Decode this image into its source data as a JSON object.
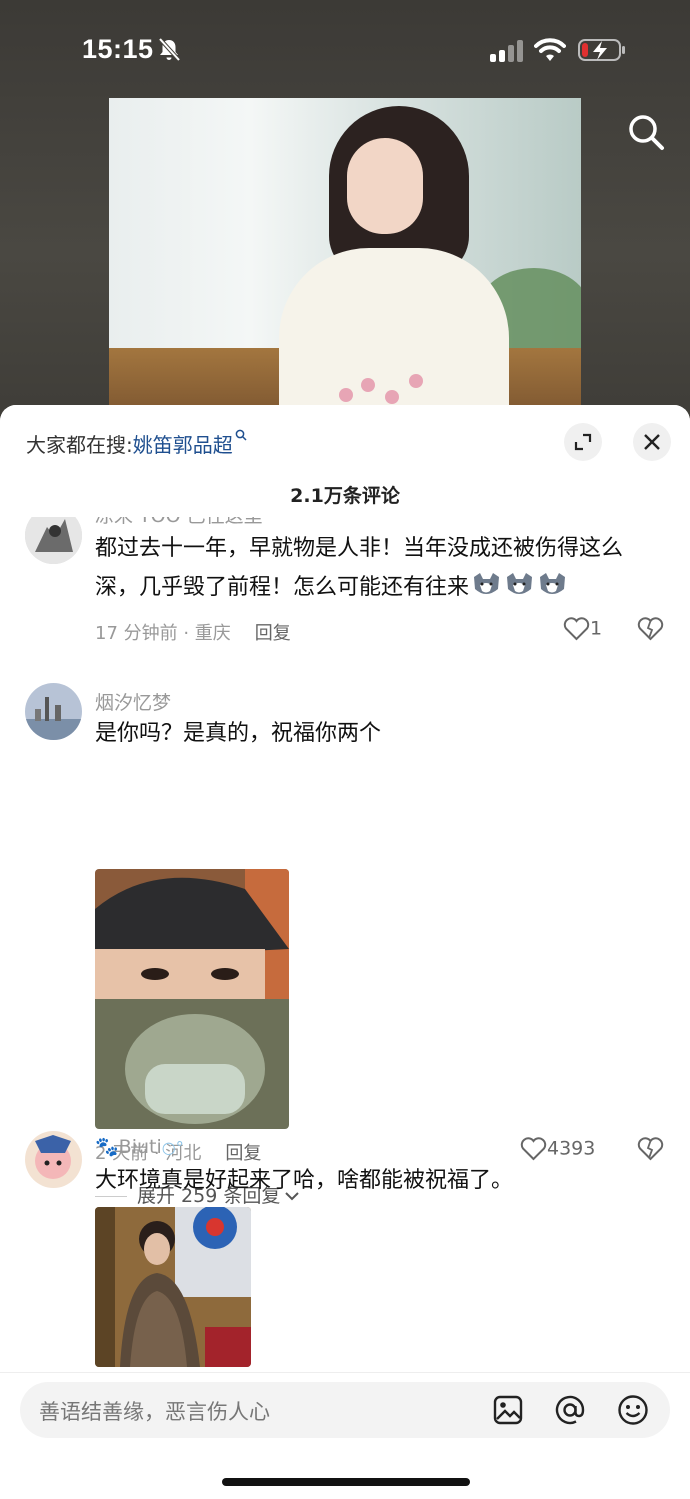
{
  "status_bar": {
    "time": "15:15"
  },
  "hot_search": {
    "prefix": "大家都在搜:",
    "keyword": "姚笛郭品超"
  },
  "comment_count": "2.1万条评论",
  "comments": [
    {
      "username": "凉宋 TOO 已往这里",
      "text": "都过去十一年，早就物是人非！当年没成还被伤得这么深，几乎毁了前程！怎么可能还有往来",
      "emoji_count": 3,
      "time_location": "17 分钟前 · 重庆",
      "reply_label": "回复",
      "likes": "1"
    },
    {
      "username": "烟汐忆梦",
      "text": "是你吗？是真的，祝福你两个",
      "time_location": "2 天前 · 河北",
      "reply_label": "回复",
      "likes": "4393",
      "expand_replies": "展开 259 条回复"
    },
    {
      "username": "Biuti",
      "text": "大环境真是好起来了哈，啥都能被祝福了。"
    }
  ],
  "input": {
    "placeholder": "善语结善缘，恶言伤人心"
  },
  "icons": [
    "bell-off-icon",
    "signal-icon",
    "wifi-icon",
    "battery-charging-icon",
    "search-icon",
    "expand-icon",
    "close-icon",
    "heart-icon",
    "dislike-icon",
    "chevron-down-icon",
    "image-icon",
    "at-icon",
    "emoji-icon"
  ],
  "colors": {
    "keyword": "#1f4f8f",
    "meta": "#999999",
    "battery_low": "#e03030"
  }
}
